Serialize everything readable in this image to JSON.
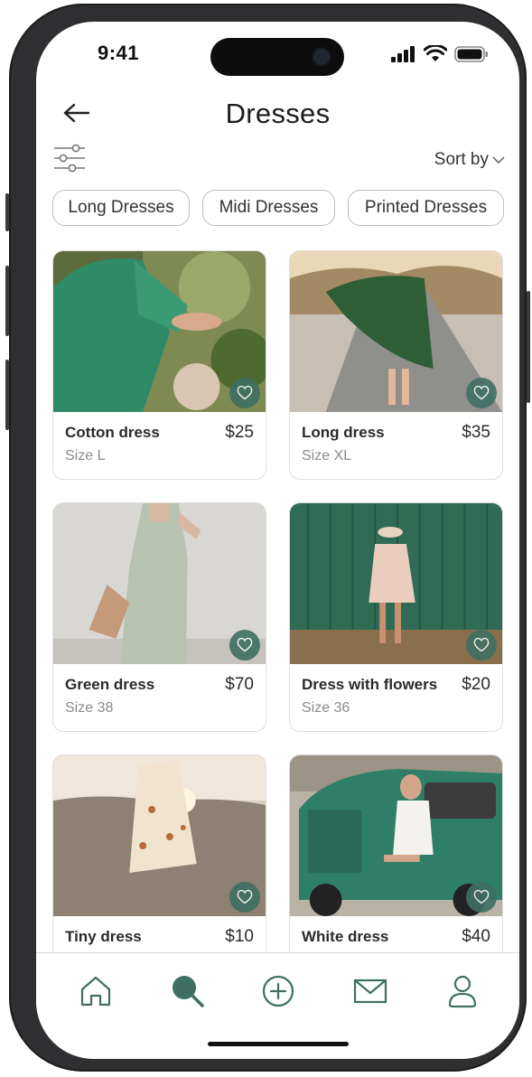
{
  "status": {
    "time": "9:41"
  },
  "header": {
    "title": "Dresses",
    "sort_label": "Sort by"
  },
  "chips": [
    "Long Dresses",
    "Midi Dresses",
    "Printed Dresses"
  ],
  "products": [
    {
      "name": "Cotton dress",
      "price": "$25",
      "size": "Size L"
    },
    {
      "name": "Long dress",
      "price": "$35",
      "size": "Size XL"
    },
    {
      "name": "Green dress",
      "price": "$70",
      "size": "Size 38"
    },
    {
      "name": "Dress with flowers",
      "price": "$20",
      "size": "Size 36"
    },
    {
      "name": "Tiny dress",
      "price": "$10",
      "size": ""
    },
    {
      "name": "White dress",
      "price": "$40",
      "size": ""
    }
  ],
  "nav": {
    "items": [
      {
        "icon": "home-icon",
        "active": false
      },
      {
        "icon": "search-icon",
        "active": true
      },
      {
        "icon": "add-circle-icon",
        "active": false
      },
      {
        "icon": "mail-icon",
        "active": false
      },
      {
        "icon": "profile-icon",
        "active": false
      }
    ]
  },
  "colors": {
    "accent": "#3f6f63",
    "icon_stroke": "#3f6f63",
    "text_dark": "#1c1c1c",
    "chip_border": "#bdbdbd",
    "card_border": "#dedede"
  }
}
